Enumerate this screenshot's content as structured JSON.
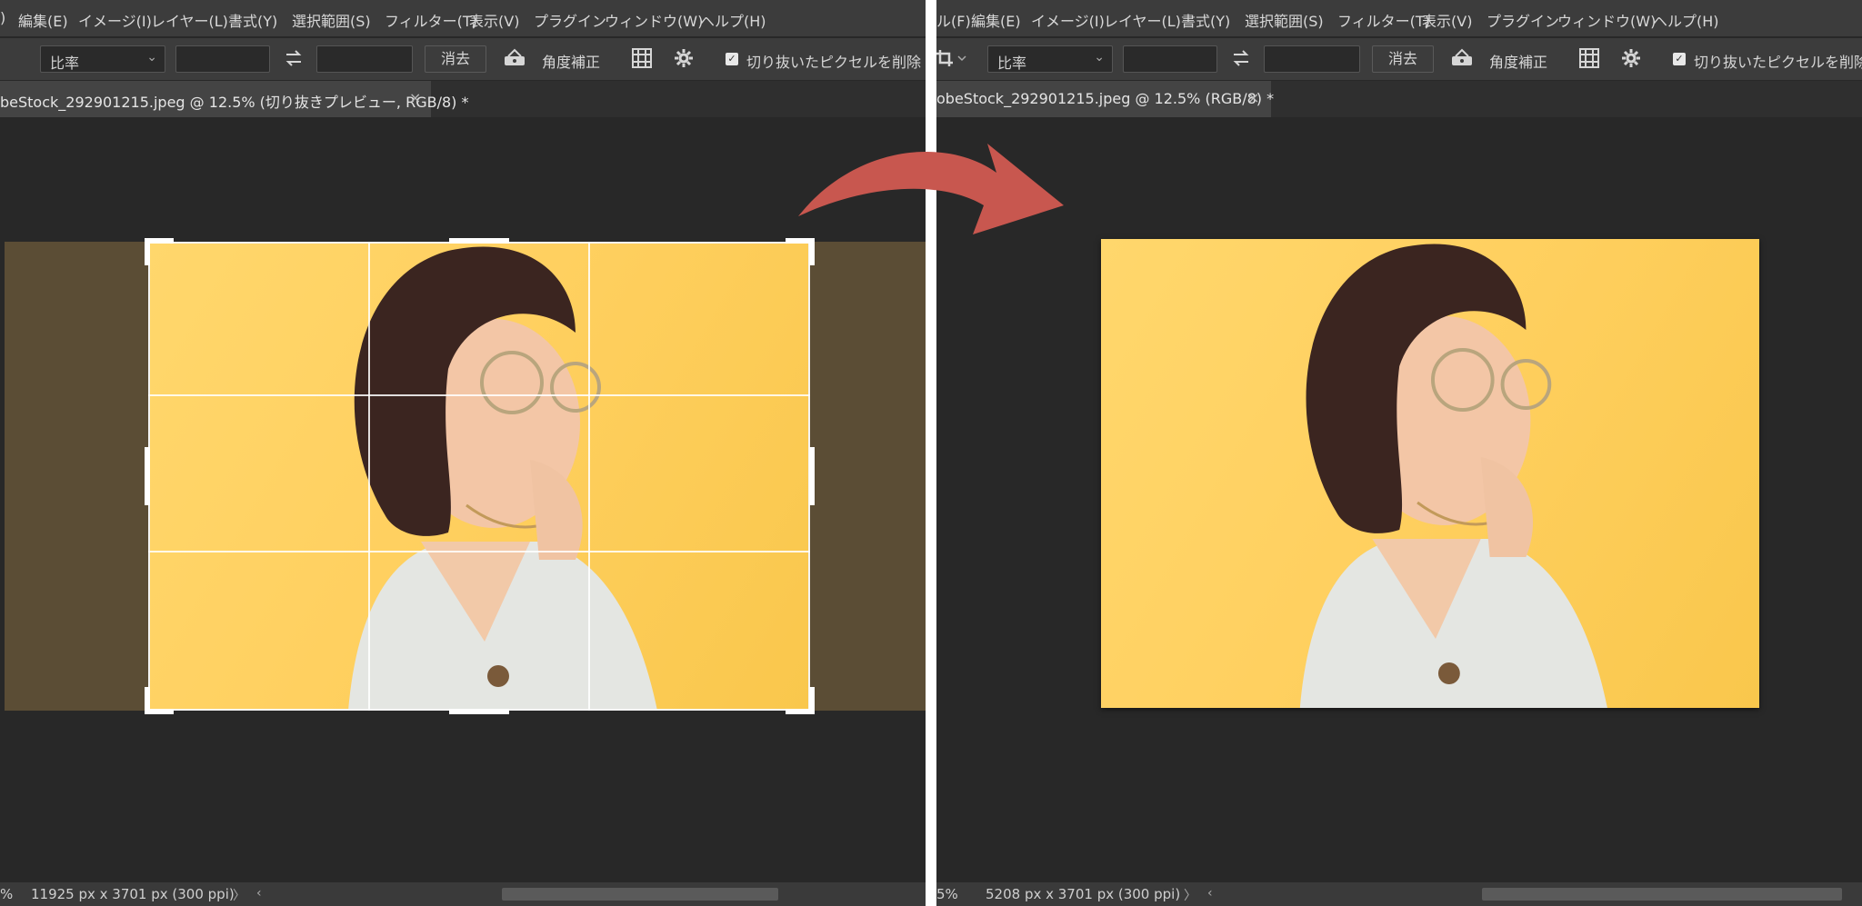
{
  "menu_left": [
    "編集(E)",
    "イメージ(I)",
    "レイヤー(L)",
    "書式(Y)",
    "選択範囲(S)",
    "フィルター(T)",
    "表示(V)",
    "プラグイン",
    "ウィンドウ(W)",
    "ヘルプ(H)"
  ],
  "menu_right": [
    "ル(F)",
    "編集(E)",
    "イメージ(I)",
    "レイヤー(L)",
    "書式(Y)",
    "選択範囲(S)",
    "フィルター(T)",
    "表示(V)",
    "プラグイン",
    "ウィンドウ(W)",
    "ヘルプ(H)"
  ],
  "options": {
    "ratio_label": "比率",
    "clear_label": "消去",
    "straighten_label": "角度補正",
    "delete_pixels_label": "切り抜いたピクセルを削除",
    "delete_pixels_checked": true
  },
  "left_doc": {
    "tab_title": "beStock_292901215.jpeg @ 12.5% (切り抜きプレビュー, RGB/8) *",
    "zoom_fragment": "%",
    "status": "11925 px x 3701 px (300 ppi)"
  },
  "right_doc": {
    "tab_title": "obeStock_292901215.jpeg @ 12.5% (RGB/8) *",
    "zoom_fragment": "5%",
    "status": "5208 px x 3701 px (300 ppi)"
  },
  "icons": {
    "swap": "swap-arrows-icon",
    "straighten": "straighten-level-icon",
    "grid": "overlay-grid-icon",
    "settings": "gear-icon",
    "crop_tool": "crop-tool-icon",
    "transition": "curved-arrow-icon"
  },
  "colors": {
    "canvas_bg": "#282828",
    "photo_yellow": "#ffd060",
    "crop_shield": "#5b4d35",
    "arrow": "#c8574f"
  }
}
